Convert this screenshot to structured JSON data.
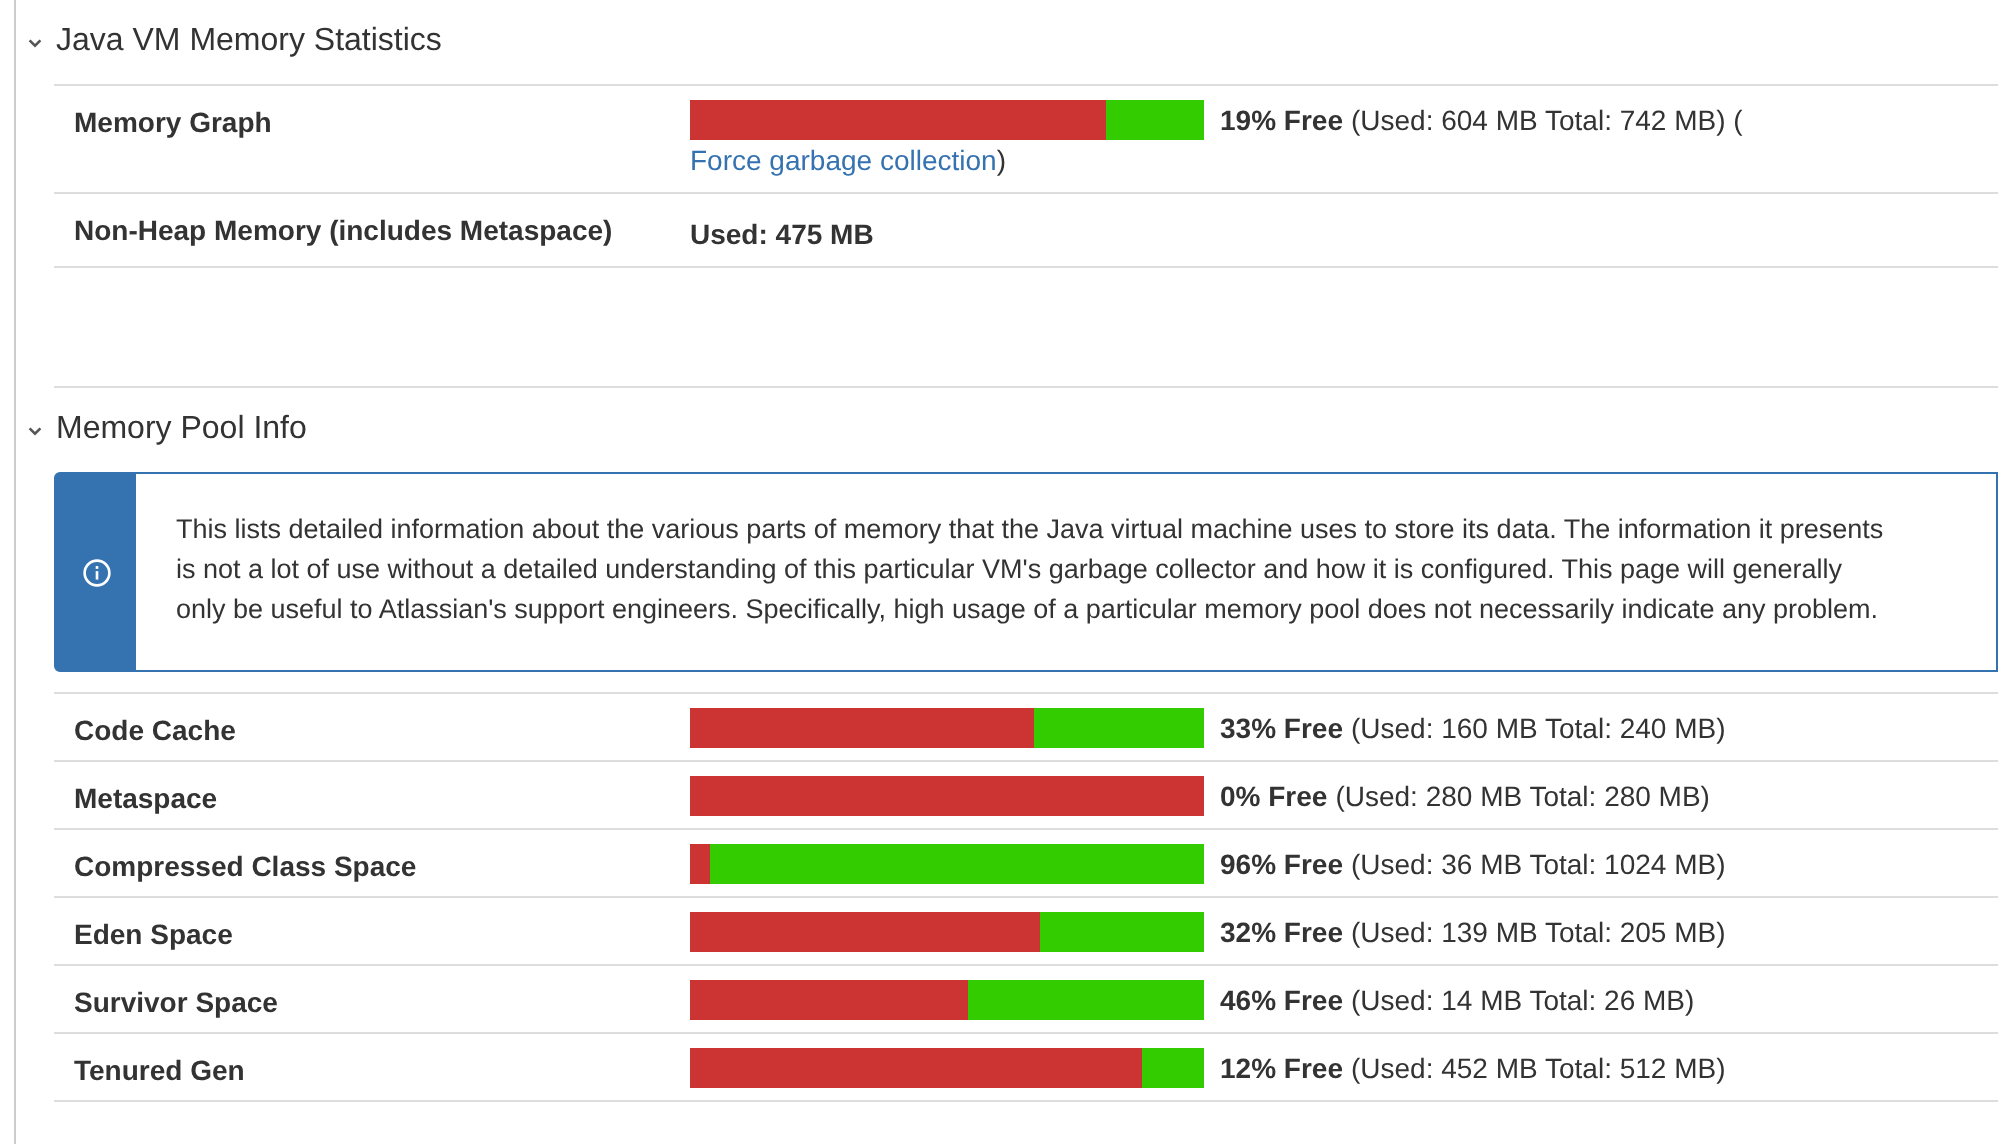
{
  "sections": [
    {
      "title": "Java VM Memory Statistics",
      "expanded": true,
      "rows": [
        {
          "kind": "bar",
          "label": "Memory Graph",
          "level": 0.81,
          "free": "19% Free",
          "detail": "(Used: 604 MB Total: 742 MB) (",
          "link": "Force garbage collection",
          "after_link": ")"
        },
        {
          "kind": "text",
          "label": "Non-Heap Memory (includes Metaspace)",
          "value": "Used: 475 MB"
        },
        {
          "kind": "empty"
        }
      ]
    },
    {
      "title": "Memory Pool Info",
      "expanded": true,
      "info": "This lists detailed information about the various parts of memory that the Java virtual machine uses to store its data. The information it presents is not a lot of use without a detailed understanding of this particular VM's garbage collector and how it is configured. This page will generally only be useful to Atlassian's support engineers. Specifically, high usage of a particular memory pool does not necessarily indicate any problem.",
      "rows": [
        {
          "kind": "bar",
          "label": "Code Cache",
          "level": 0.67,
          "free": "33% Free",
          "detail": "(Used: 160 MB Total: 240 MB)"
        },
        {
          "kind": "bar",
          "label": "Metaspace",
          "level": 1.0,
          "free": "0% Free",
          "detail": "(Used: 280 MB Total: 280 MB)"
        },
        {
          "kind": "bar",
          "label": "Compressed Class Space",
          "level": 0.04,
          "free": "96% Free",
          "detail": "(Used: 36 MB Total: 1024 MB)"
        },
        {
          "kind": "bar",
          "label": "Eden Space",
          "level": 0.68,
          "free": "32% Free",
          "detail": "(Used: 139 MB Total: 205 MB)"
        },
        {
          "kind": "bar",
          "label": "Survivor Space",
          "level": 0.54,
          "free": "46% Free",
          "detail": "(Used: 14 MB Total: 26 MB)"
        },
        {
          "kind": "bar",
          "label": "Tenured Gen",
          "level": 0.88,
          "free": "12% Free",
          "detail": "(Used: 452 MB Total: 512 MB)"
        }
      ]
    }
  ]
}
